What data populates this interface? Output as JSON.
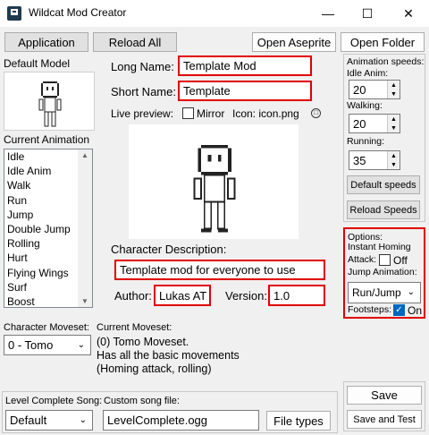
{
  "window": {
    "title": "Wildcat Mod Creator"
  },
  "toolbar": {
    "application": "Application",
    "reload_all": "Reload All",
    "open_aseprite": "Open Aseprite",
    "open_folder": "Open Folder"
  },
  "left": {
    "default_model_label": "Default Model",
    "current_animation_label": "Current Animation",
    "animations": [
      "Idle",
      "Idle Anim",
      "Walk",
      "Run",
      "Jump",
      "Double Jump",
      "Rolling",
      "Hurt",
      "Flying Wings",
      "Surf",
      "Boost"
    ]
  },
  "center": {
    "long_name_label": "Long Name:",
    "long_name_value": "Template Mod",
    "short_name_label": "Short Name:",
    "short_name_value": "Template",
    "live_preview_label": "Live preview:",
    "mirror_label": "Mirror",
    "icon_label": "Icon: icon.png",
    "char_desc_label": "Character Description:",
    "char_desc_value": "Template mod for everyone to use",
    "author_label": "Author:",
    "author_value": "Lukas AT",
    "version_label": "Version:",
    "version_value": "1.0"
  },
  "right": {
    "anim_speeds_label": "Animation speeds:",
    "idle_anim_label": "Idle Anim:",
    "idle_anim_value": "20",
    "walking_label": "Walking:",
    "walking_value": "20",
    "running_label": "Running:",
    "running_value": "35",
    "default_speeds": "Default speeds",
    "reload_speeds": "Reload Speeds",
    "options_label": "Options:",
    "instant_homing_label": "Instant Homing",
    "attack_label": "Attack:",
    "attack_off": "Off",
    "jump_anim_label": "Jump Animation:",
    "jump_anim_value": "Run/Jump",
    "footsteps_label": "Footsteps:",
    "footsteps_on": "On",
    "save": "Save",
    "save_and_test": "Save and Test"
  },
  "moveset": {
    "char_moveset_label": "Character Moveset:",
    "char_moveset_value": "0 - Tomo",
    "current_moveset_label": "Current Moveset:",
    "desc_lines": [
      "(0) Tomo Moveset.",
      "Has all the basic movements",
      "(Homing attack, rolling)"
    ]
  },
  "song": {
    "level_complete_label": "Level Complete Song:",
    "level_complete_value": "Default",
    "custom_song_label": "Custom song file:",
    "custom_song_value": "LevelComplete.ogg",
    "file_types": "File types"
  }
}
